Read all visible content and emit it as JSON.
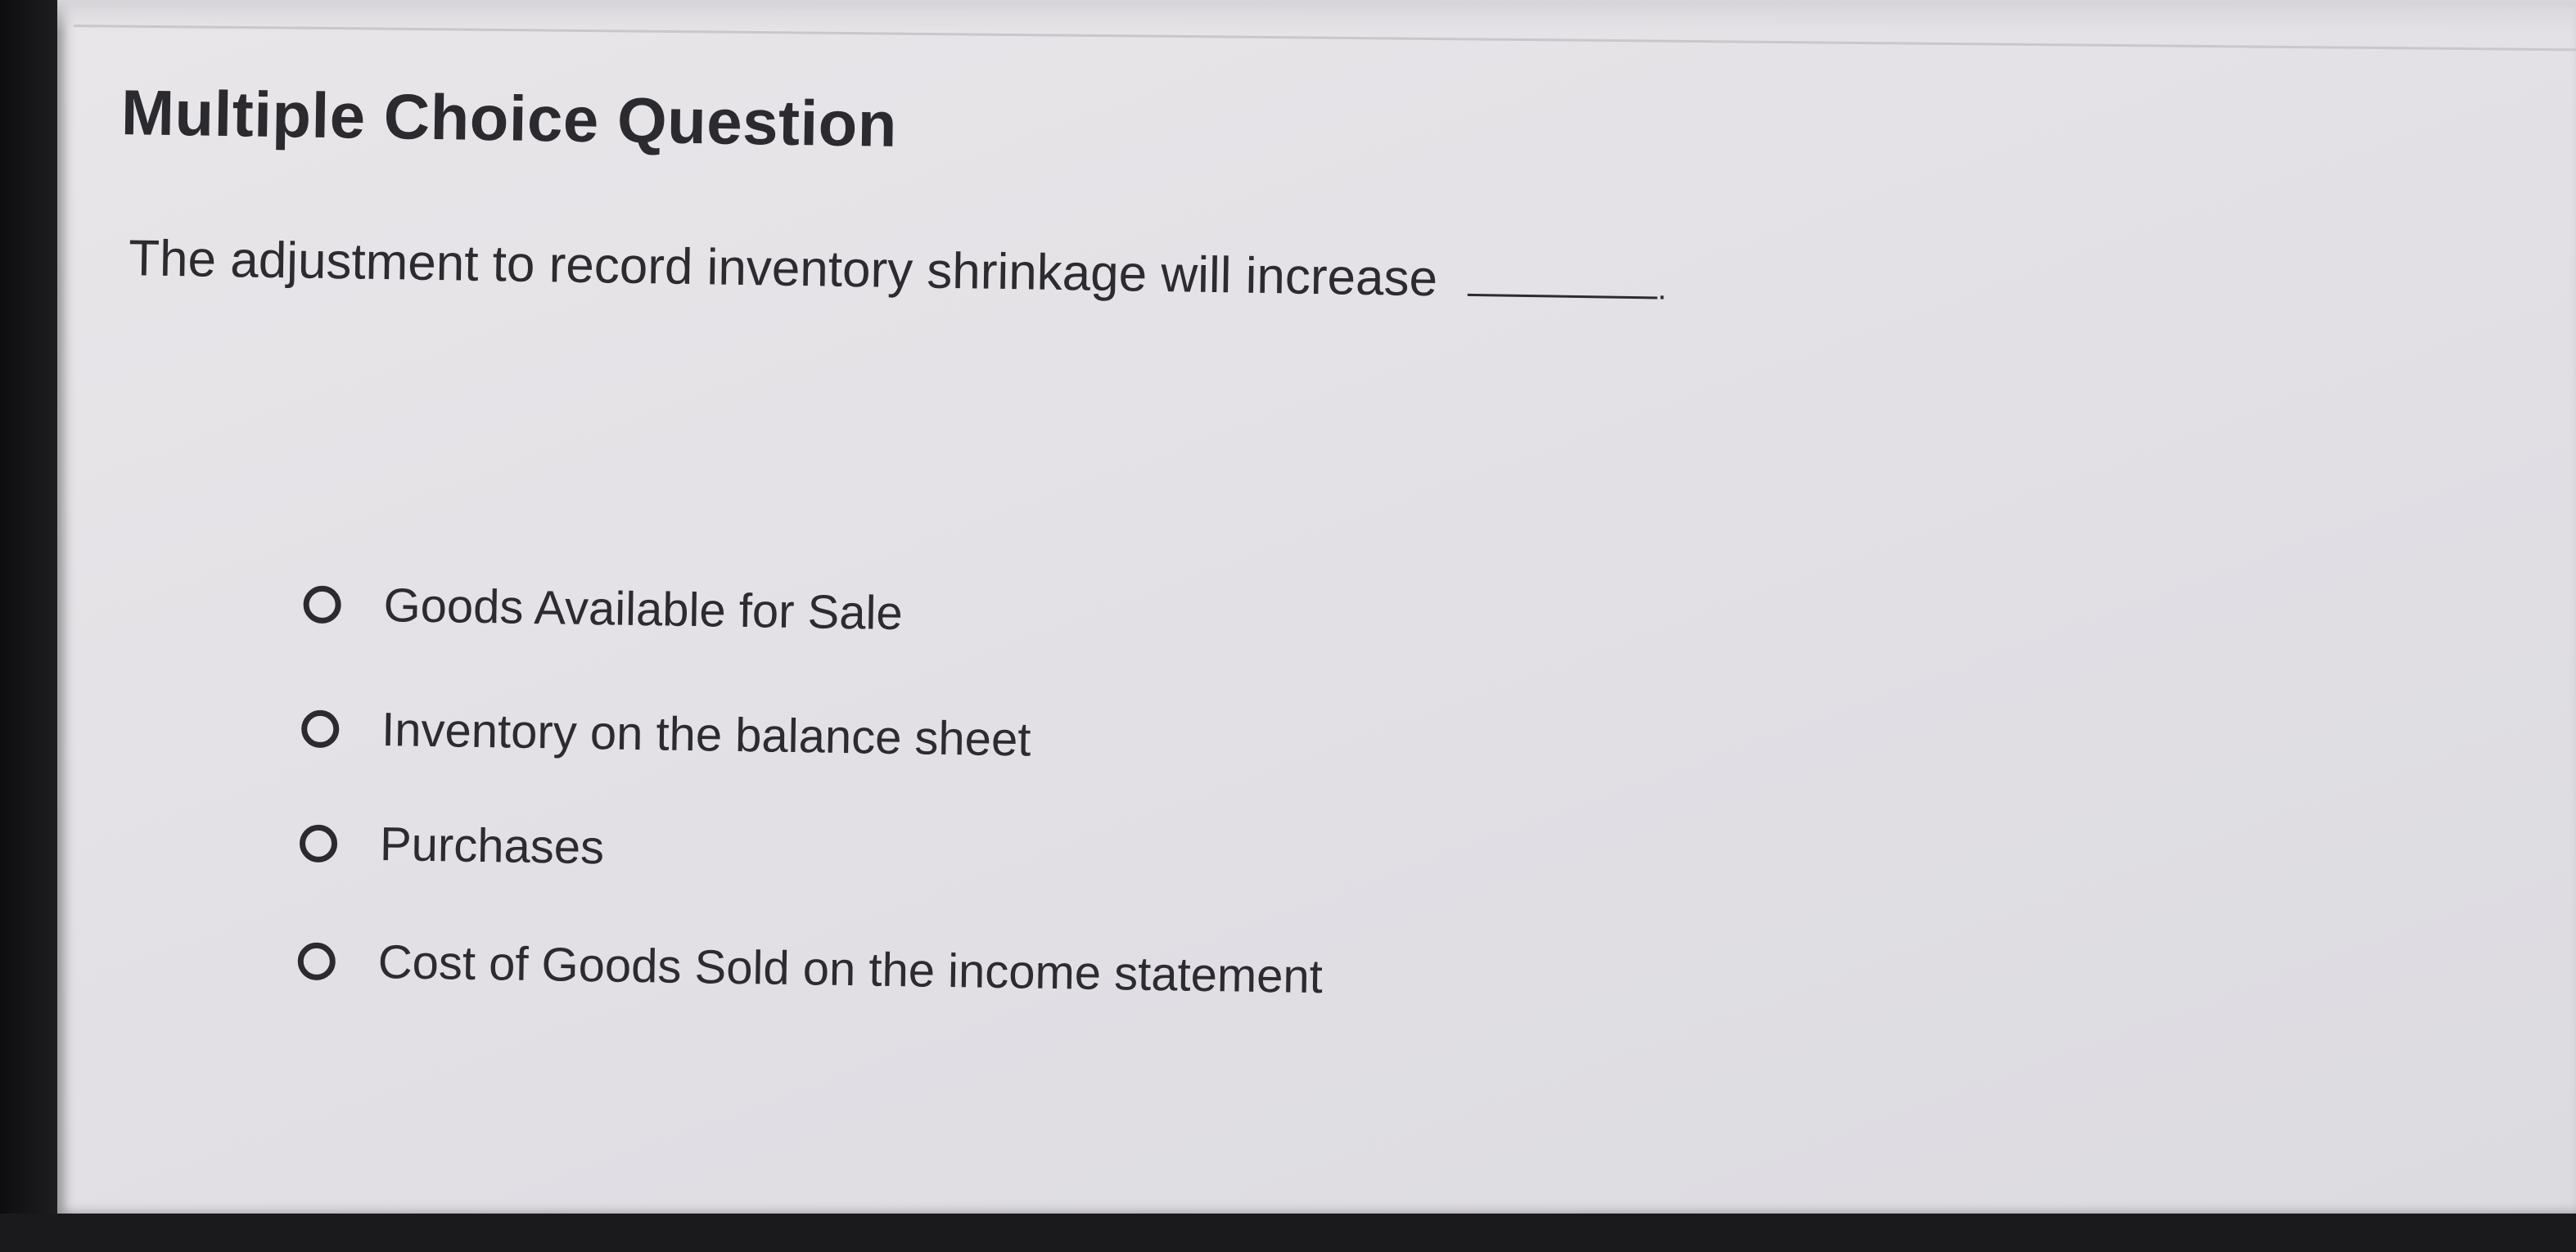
{
  "question": {
    "heading": "Multiple Choice Question",
    "prompt": "The adjustment to record inventory shrinkage will increase",
    "blank_suffix": "."
  },
  "options": [
    {
      "label": "Goods Available for Sale",
      "selected": false
    },
    {
      "label": "Inventory on the balance sheet",
      "selected": false
    },
    {
      "label": "Purchases",
      "selected": false
    },
    {
      "label": "Cost of Goods Sold on the income statement",
      "selected": false
    }
  ]
}
